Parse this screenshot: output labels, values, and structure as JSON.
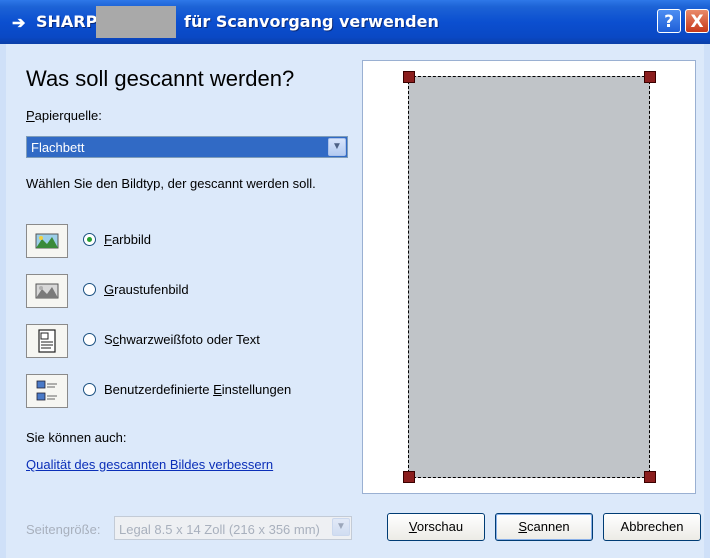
{
  "window": {
    "title_prefix": "SHARP",
    "title_suffix": "für Scanvorgang verwenden",
    "help_label": "?",
    "close_label": "X"
  },
  "main": {
    "heading": "Was soll gescannt werden?",
    "source_label_accel": "P",
    "source_label_rest": "apierquelle:",
    "source_value": "Flachbett",
    "type_prompt": "Wählen Sie den Bildtyp, der gescannt werden soll.",
    "options": [
      {
        "accel": "F",
        "rest": "arbbild",
        "selected": true,
        "icon": "color-photo-icon"
      },
      {
        "accel": "G",
        "rest": "raustufenbild",
        "selected": false,
        "icon": "grayscale-photo-icon"
      },
      {
        "pre": "S",
        "accel": "c",
        "rest": "hwarzweißfoto oder Text",
        "selected": false,
        "icon": "bw-text-icon"
      },
      {
        "pre": "Benutzerdefinierte ",
        "accel": "E",
        "rest": "instellungen",
        "selected": false,
        "icon": "custom-settings-icon"
      }
    ],
    "also_label": "Sie können auch:",
    "quality_link": "Qualität des gescannten Bildes verbessern",
    "page_size_label": "Seitengröße:",
    "page_size_value": "Legal 8.5 x 14 Zoll (216 x 356 mm)"
  },
  "buttons": {
    "preview": {
      "accel": "V",
      "rest": "orschau"
    },
    "scan": {
      "accel": "S",
      "rest": "cannen"
    },
    "cancel": "Abbrechen"
  },
  "colors": {
    "titlebar": "#0b4fd0",
    "selection": "#316ac5",
    "link": "#0b2fb8",
    "marker": "#8b1e1e"
  }
}
